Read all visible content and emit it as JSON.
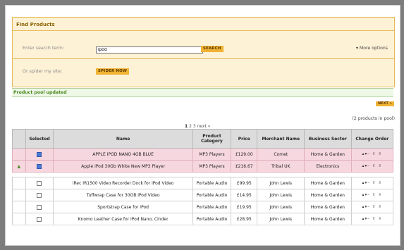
{
  "find_products": {
    "title": "Find Products",
    "search_label": "Enter search term:",
    "search_value": "ipod",
    "search_button": "SEARCH",
    "more_options": "▾ More options",
    "spider_label": "Or spider my site:",
    "spider_button": "SPIDER NOW"
  },
  "status": {
    "message": "Product pool updated"
  },
  "pool": {
    "next_button": "NEXT »",
    "count": "(2 products in pool)",
    "pagination_current": "1",
    "pagination_links": "2 3",
    "pagination_next": "next »"
  },
  "table": {
    "headers": [
      "",
      "Selected",
      "Name",
      "Product Category",
      "Price",
      "Merchant Name",
      "Business Sector",
      "Change Order"
    ],
    "selected_rows": [
      {
        "arrow": "",
        "checked": true,
        "name": "APPLE IPOD NANO 4GB BLUE",
        "category": "MP3 Players",
        "price": "£129.00",
        "merchant": "Comet",
        "sector": "Home & Garden",
        "order": "▴▾– ⇧ ⇩"
      },
      {
        "arrow": "▲",
        "checked": true,
        "name": "Apple iPod 30Gb White New MP3 Player",
        "category": "MP3 Players",
        "price": "£216.67",
        "merchant": "Tribal UK",
        "sector": "Electronics",
        "order": "▴▾– ⇧ ⇩"
      }
    ],
    "rows": [
      {
        "checked": false,
        "name": "iRec IR1500 Video Recorder Dock for iPod Video",
        "category": "Portable Audio",
        "price": "£99.95",
        "merchant": "John Lewis",
        "sector": "Home & Garden",
        "order": "▴▾– ⇧ ⇩"
      },
      {
        "checked": false,
        "name": "Tuffwrap Case for 30GB iPod Video",
        "category": "Portable Audio",
        "price": "£14.95",
        "merchant": "John Lewis",
        "sector": "Home & Garden",
        "order": "▴▾– ⇧ ⇩"
      },
      {
        "checked": false,
        "name": "Sportstrap Case for iPod",
        "category": "Portable Audio",
        "price": "£19.95",
        "merchant": "John Lewis",
        "sector": "Home & Garden",
        "order": "▴▾– ⇧ ⇩"
      },
      {
        "checked": false,
        "name": "Knomo Leather Case for iPod Nano, Cinder",
        "category": "Portable Audio",
        "price": "£28.95",
        "merchant": "John Lewis",
        "sector": "Home & Garden",
        "order": "▴▾– ⇧ ⇩"
      }
    ]
  },
  "colors": {
    "accent": "#f1b335",
    "panel_bg": "#fdf2d6",
    "selected_row": "#f7d7df",
    "status_green": "#4b8a24"
  }
}
